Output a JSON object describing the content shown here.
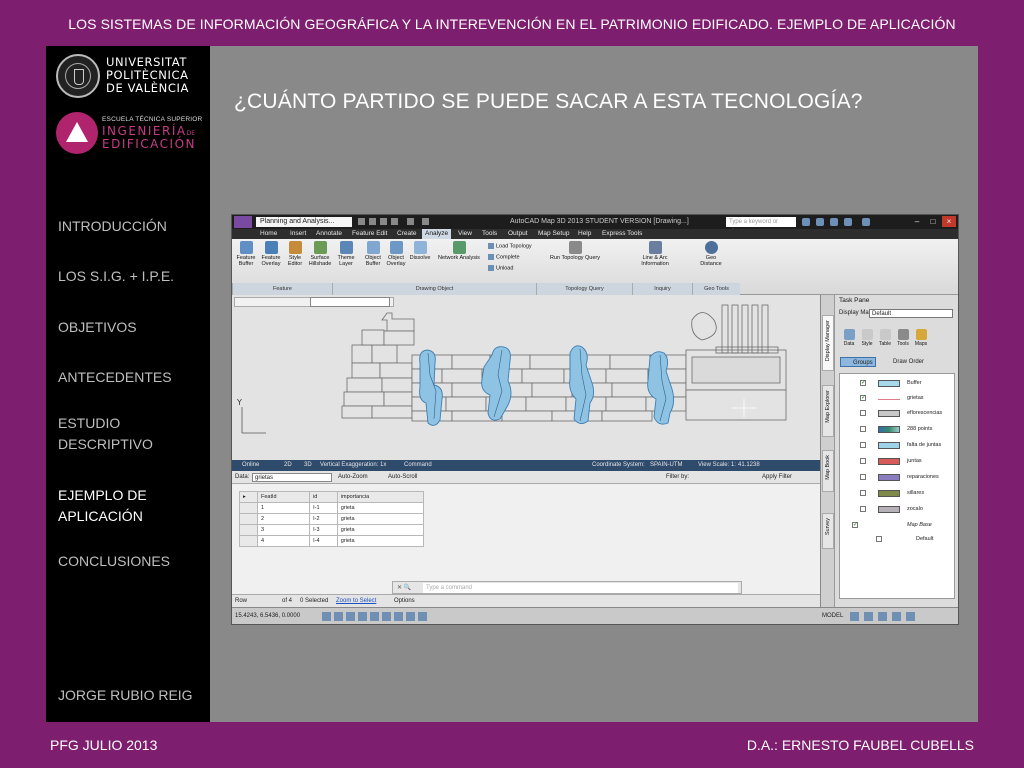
{
  "slide": {
    "top_title": "LOS SISTEMAS DE INFORMACIÓN GEOGRÁFICA Y LA INTEREVENCIÓN EN EL PATRIMONIO EDIFICADO. EJEMPLO DE APLICACIÓN",
    "heading": "¿CUÁNTO PARTIDO SE PUEDE SACAR A ESTA TECNOLOGÍA?",
    "footer_left": "PFG JULIO 2013",
    "footer_right": "D.A.: ERNESTO FAUBEL CUBELLS",
    "author": "JORGE RUBIO REIG",
    "colors": {
      "background": "#7d1e6e",
      "frame": "#898989",
      "sidebar": "#000000",
      "accent": "#c63b86"
    }
  },
  "logos": {
    "upv": [
      "UNIVERSITAT",
      "POLITÈCNICA",
      "DE VALÈNCIA"
    ],
    "ete_small": "ESCUELA TÉCNICA SUPERIOR",
    "ete_big": [
      "INGENIERÍA",
      "EDIFICACIÓN"
    ],
    "ete_de": "DE"
  },
  "nav": [
    {
      "label": "INTRODUCCIÓN"
    },
    {
      "label": "LOS S.I.G. + I.P.E."
    },
    {
      "label": "OBJETIVOS"
    },
    {
      "label": "ANTECEDENTES"
    },
    {
      "label": "ESTUDIO DESCRIPTIVO"
    },
    {
      "label": "EJEMPLO DE APLICACIÓN"
    },
    {
      "label": "CONCLUSIONES"
    }
  ],
  "app": {
    "workspace": "Planning and Analysis...",
    "window_title": "AutoCAD Map 3D 2013  STUDENT VERSION  [Drawing...]",
    "search_placeholder": "Type a keyword or phrase",
    "menu": [
      "Home",
      "Insert",
      "Annotate",
      "Feature Edit",
      "Create",
      "Analyze",
      "View",
      "Tools",
      "Output",
      "Map Setup",
      "Help",
      "Express Tools"
    ],
    "selected_menu": "Analyze",
    "ribbon_tools": [
      {
        "label": "Feature Buffer"
      },
      {
        "label": "Feature Overlay"
      },
      {
        "label": "Style Editor"
      },
      {
        "label": "Surface Hillshade"
      },
      {
        "label": "Theme Layer"
      },
      {
        "label": "Object Buffer"
      },
      {
        "label": "Object Overlay"
      },
      {
        "label": "Dissolve"
      },
      {
        "label": "Network Analysis"
      }
    ],
    "ribbon_small": [
      "Load Topology",
      "Complete",
      "Unload"
    ],
    "ribbon_more": [
      {
        "label": "Run Topology Query"
      },
      {
        "label": "Line & Arc Information"
      },
      {
        "label": "Geo Distance"
      }
    ],
    "ribbon_groups": [
      "Feature",
      "Drawing Object",
      "Topology Query",
      "Inquiry",
      "Geo Tools"
    ],
    "axis_label": "Y",
    "status1": {
      "online": "Online",
      "mode_2d": "2D",
      "mode_3d": "3D",
      "vert_exag": "Vertical Exaggeration:",
      "vert_value": "1x",
      "command": "Command",
      "coord_label": "Coordinate System:",
      "coord_value": "SPAIN-UTM",
      "view_scale_label": "View Scale: 1:",
      "view_scale_value": "41.1238"
    },
    "data_panel": {
      "data_label": "Data:",
      "data_value": "grietas",
      "auto_zoom": "Auto-Zoom",
      "auto_scroll": "Auto-Scroll",
      "filter_label": "Filter by:",
      "apply_filter": "Apply Filter",
      "columns": [
        "FeatId",
        "id",
        "importancia"
      ],
      "rows": [
        [
          "1",
          "I-1",
          "grieta"
        ],
        [
          "2",
          "I-2",
          "grieta"
        ],
        [
          "3",
          "I-3",
          "grieta"
        ],
        [
          "4",
          "I-4",
          "grieta"
        ]
      ]
    },
    "command_placeholder": "Type a command",
    "record_bar": {
      "row_label": "Row",
      "of_count": "of 4",
      "selected": "0 Selected",
      "zoom_to_select": "Zoom to Select",
      "options": "Options"
    },
    "coords": "15.4243, 6.5436, 0.0000",
    "model": "MODEL",
    "task_pane": {
      "title": "Task Pane",
      "display_map_label": "Display Map:",
      "display_map_value": "Default",
      "buttons": [
        "Data",
        "Style",
        "Table",
        "Tools",
        "Maps"
      ],
      "view_tabs": [
        "Groups",
        "Draw Order"
      ],
      "side_tabs": [
        "Display Manager",
        "Map Explorer",
        "Map Book",
        "Survey"
      ],
      "layers": [
        {
          "name": "Buffer",
          "color": "#a8d8ec",
          "checked": true
        },
        {
          "name": "grietas",
          "color": "#e07b8a",
          "checked": true
        },
        {
          "name": "eflorescencias",
          "color": "#c8c8c8",
          "checked": false
        },
        {
          "name": "288 points",
          "color": "#3a8a6a",
          "checked": false
        },
        {
          "name": "falta de juntas",
          "color": "#9fd4e8",
          "checked": false
        },
        {
          "name": "juntas",
          "color": "#d85b5b",
          "checked": false
        },
        {
          "name": "reparaciones",
          "color": "#8a7cc0",
          "checked": false
        },
        {
          "name": "sillares",
          "color": "#7f8a4a",
          "checked": false
        },
        {
          "name": "zocalo",
          "color": "#b8b0b8",
          "checked": false
        },
        {
          "name": "Map Base",
          "color": "",
          "checked": true
        },
        {
          "name": "Default",
          "color": "",
          "checked": false
        }
      ]
    }
  }
}
